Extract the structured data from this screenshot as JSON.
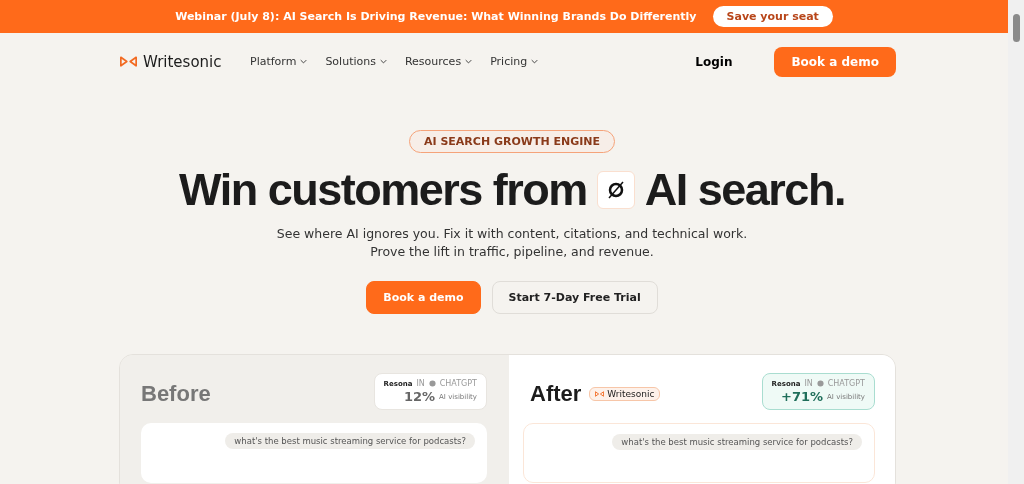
{
  "announcement": {
    "text": "Webinar (July 8): AI Search Is Driving Revenue: What Winning Brands Do Differently",
    "button": "Save your seat"
  },
  "nav": {
    "logo": "Writesonic",
    "items": [
      {
        "label": "Platform"
      },
      {
        "label": "Solutions"
      },
      {
        "label": "Resources"
      },
      {
        "label": "Pricing"
      }
    ],
    "login": "Login",
    "cta": "Book a demo"
  },
  "hero": {
    "eyebrow": "AI SEARCH GROWTH ENGINE",
    "headline_before": "Win customers from",
    "headline_after": "AI search.",
    "subtitle_lines": [
      "See where AI ignores you. Fix it with content, citations, and technical work.",
      "Prove the lift in traffic, pipeline, and revenue."
    ],
    "buttons": [
      {
        "label": "Book a demo",
        "kind": "primary"
      },
      {
        "label": "Start 7-Day Free Trial",
        "kind": "secondary"
      }
    ]
  },
  "comparison": [
    {
      "kind": "before",
      "title": "Before",
      "metric": {
        "brand": "Resona",
        "in": "IN",
        "engine": "CHATGPT",
        "value": "12%",
        "label": "AI visibility"
      },
      "prompt": "what's the best music streaming service for podcasts?"
    },
    {
      "kind": "after",
      "title": "After",
      "tag": "Writesonic",
      "metric": {
        "brand": "Resona",
        "in": "IN",
        "engine": "CHATGPT",
        "value": "+71%",
        "label": "AI visibility"
      },
      "prompt": "what's the best music streaming service for podcasts?"
    }
  ]
}
